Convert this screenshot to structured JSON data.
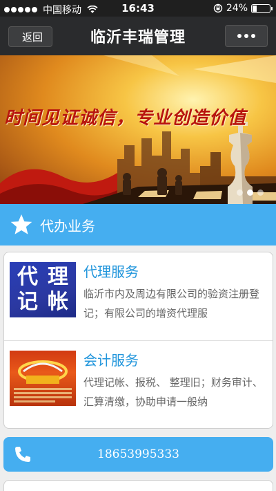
{
  "status_bar": {
    "carrier": "中国移动",
    "time": "16:43",
    "battery": "24%",
    "battery_level": 0.24
  },
  "nav": {
    "back_label": "返回",
    "title": "临沂丰瑞管理"
  },
  "banner": {
    "slogan": "时间见证诚信，专业创造价值",
    "slide_count": 3,
    "active_slide": 2
  },
  "section": {
    "title": "代办业务"
  },
  "services": [
    {
      "title": "代理服务",
      "description": "临沂市内及周边有限公司的验资注册登记；有限公司的增资代理服",
      "thumb_chars": [
        "代",
        "理",
        "记",
        "帐"
      ]
    },
    {
      "title": "会计服务",
      "description": "代理记帐、报税、 整理旧；财务审计、汇算清缴，协助申请一般纳"
    }
  ],
  "contact": {
    "phone": "18653995333"
  },
  "colors": {
    "accent": "#45aef0",
    "title_blue": "#2296dc",
    "nav_bg": "#2a2b2d"
  }
}
